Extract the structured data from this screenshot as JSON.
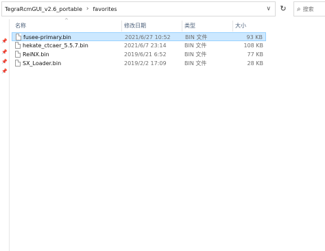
{
  "address_bar": {
    "crumbs": [
      "TegraRcmGUI_v2.6_portable",
      "favorites"
    ],
    "separator": "›",
    "dropdown_glyph": "∨"
  },
  "refresh_icon": "↻",
  "search": {
    "glass": "⌕",
    "placeholder": "搜索"
  },
  "nav_pins": [
    "📌",
    "📌",
    "📌",
    "📌"
  ],
  "columns": {
    "name": "名称",
    "modified": "修改日期",
    "type": "类型",
    "size": "大小",
    "sort_indicator": "^"
  },
  "files": [
    {
      "name": "fusee-primary.bin",
      "modified": "2021/6/27 10:52",
      "type": "BIN 文件",
      "size": "93 KB",
      "selected": true
    },
    {
      "name": "hekate_ctcaer_5.5.7.bin",
      "modified": "2021/6/7 23:14",
      "type": "BIN 文件",
      "size": "108 KB",
      "selected": false
    },
    {
      "name": "ReiNX.bin",
      "modified": "2019/6/21 6:52",
      "type": "BIN 文件",
      "size": "77 KB",
      "selected": false
    },
    {
      "name": "SX_Loader.bin",
      "modified": "2019/2/2 17:09",
      "type": "BIN 文件",
      "size": "28 KB",
      "selected": false
    }
  ]
}
